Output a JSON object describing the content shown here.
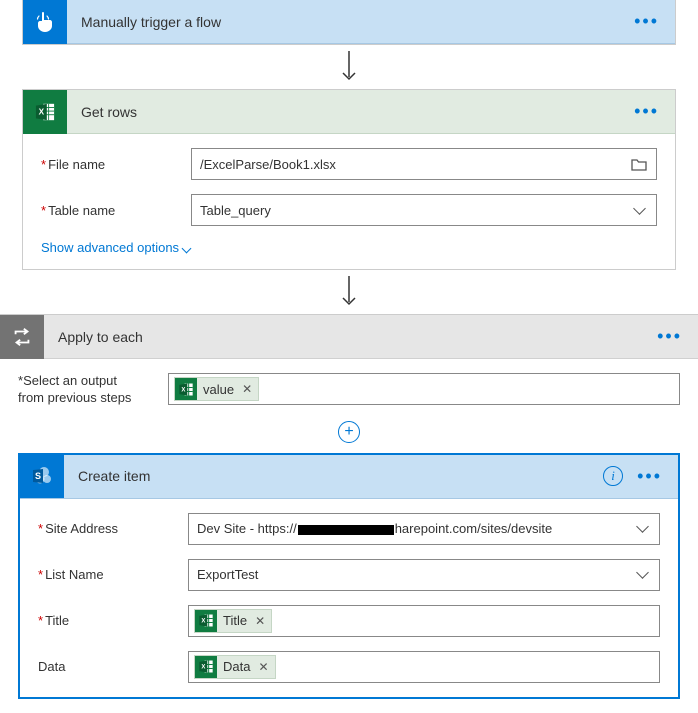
{
  "trigger": {
    "title": "Manually trigger a flow"
  },
  "getrows": {
    "title": "Get rows",
    "fields": {
      "file_label": "File name",
      "file_value": "/ExcelParse/Book1.xlsx",
      "table_label": "Table name",
      "table_value": "Table_query"
    },
    "advanced": "Show advanced options"
  },
  "apply": {
    "title": "Apply to each",
    "select_label_l1": "Select an output",
    "select_label_l2": "from previous steps",
    "token_value": "value"
  },
  "createitem": {
    "title": "Create item",
    "fields": {
      "site_label": "Site Address",
      "site_prefix": "Dev Site - https://",
      "site_suffix": "harepoint.com/sites/devsite",
      "list_label": "List Name",
      "list_value": "ExportTest",
      "title_label": "Title",
      "title_token": "Title",
      "data_label": "Data",
      "data_token": "Data"
    }
  }
}
